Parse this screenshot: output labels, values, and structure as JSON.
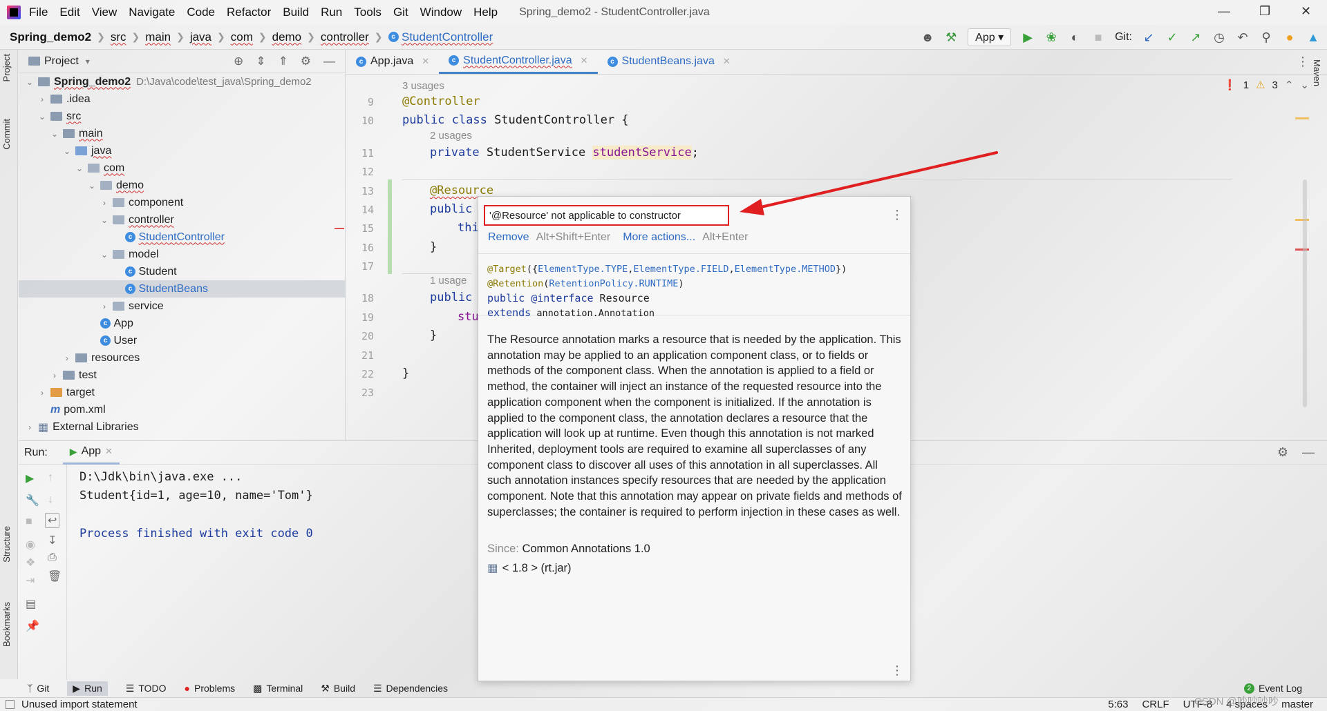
{
  "menu": {
    "items": [
      "File",
      "Edit",
      "View",
      "Navigate",
      "Code",
      "Refactor",
      "Build",
      "Run",
      "Tools",
      "Git",
      "Window",
      "Help"
    ],
    "title": "Spring_demo2 - StudentController.java"
  },
  "breadcrumb": [
    "Spring_demo2",
    "src",
    "main",
    "java",
    "com",
    "demo",
    "controller",
    "StudentController"
  ],
  "toolbar": {
    "run_config": "App",
    "git_label": "Git:"
  },
  "side_tabs": {
    "project": "Project",
    "commit": "Commit",
    "structure": "Structure",
    "bookmarks": "Bookmarks",
    "maven": "Maven"
  },
  "project_panel": {
    "title": "Project",
    "root_name": "Spring_demo2",
    "root_path": "D:\\Java\\code\\test_java\\Spring_demo2",
    "items": {
      "idea": ".idea",
      "src": "src",
      "main": "main",
      "java": "java",
      "com": "com",
      "demo": "demo",
      "component": "component",
      "controller": "controller",
      "studentcontroller": "StudentController",
      "model": "model",
      "student": "Student",
      "studentbeans": "StudentBeans",
      "service": "service",
      "app": "App",
      "user": "User",
      "resources": "resources",
      "test": "test",
      "target": "target",
      "pom": "pom.xml",
      "extlibs": "External Libraries"
    }
  },
  "editor": {
    "tabs": [
      "App.java",
      "StudentController.java",
      "StudentBeans.java"
    ],
    "active_tab": "StudentController.java",
    "inspection": {
      "errors": "1",
      "warnings": "3"
    },
    "line_numbers": [
      "9",
      "10",
      "11",
      "12",
      "13",
      "14",
      "15",
      "16",
      "17",
      "18",
      "19",
      "20",
      "21",
      "22",
      "23"
    ],
    "hints": {
      "h1": "3 usages",
      "h2": "2 usages",
      "h3": "1 usage"
    },
    "code": {
      "l9": "@Controller",
      "l10_kw": "public class",
      "l10_rest": " StudentController {",
      "l11_kw": "private",
      "l11_type": " StudentService ",
      "l11_field": "studentService",
      "l11_end": ";",
      "l13": "@Resource",
      "l14": "public",
      "l15": "thi",
      "l16": "}",
      "l18": "public",
      "l19": "stu",
      "l20": "}",
      "l22": "}"
    }
  },
  "popup": {
    "error": "'@Resource' not applicable to constructor",
    "action1": "Remove",
    "action1_shortcut": "Alt+Shift+Enter",
    "action2": "More actions...",
    "action2_shortcut": "Alt+Enter",
    "sig": {
      "target_ann": "@Target",
      "target_open": "({",
      "et1": "ElementType.TYPE",
      "et2": "ElementType.FIELD",
      "et3": "ElementType.METHOD",
      "target_close": "})",
      "retention_ann": "@Retention",
      "retention_open": "(",
      "retention_val": "RetentionPolicy.RUNTIME",
      "retention_close": ")",
      "decl_kw": "public @interface",
      "decl_name": " Resource",
      "extends_kw": "extends",
      "extends_name": " annotation.Annotation"
    },
    "description": "The Resource annotation marks a resource that is needed by the application. This annotation may be applied to an application component class, or to fields or methods of the component class. When the annotation is applied to a field or method, the container will inject an instance of the requested resource into the application component when the component is initialized. If the annotation is applied to the component class, the annotation declares a resource that the application will look up at runtime. Even though this annotation is not marked Inherited, deployment tools are required to examine all superclasses of any component class to discover all uses of this annotation in all superclasses. All such annotation instances specify resources that are needed by the application component. Note that this annotation may appear on private fields and methods of superclasses; the container is required to perform injection in these cases as well.",
    "since_label": "Since:",
    "since_value": "Common Annotations 1.0",
    "jdk": "< 1.8 > (rt.jar)"
  },
  "run_panel": {
    "label": "Run:",
    "tab": "App",
    "output": [
      "D:\\Jdk\\bin\\java.exe ...",
      "Student{id=1, age=10, name='Tom'}",
      "",
      "Process finished with exit code 0"
    ]
  },
  "bottom_tools": [
    "Git",
    "Run",
    "TODO",
    "Problems",
    "Terminal",
    "Build",
    "Dependencies"
  ],
  "event_log": {
    "count": "2",
    "label": "Event Log"
  },
  "status": {
    "message": "Unused import statement",
    "position": "5:63",
    "line_sep": "CRLF",
    "encoding": "UTF-8",
    "indent": "4 spaces",
    "branch": "master",
    "watermark": "CSDN @吵吵吵吵"
  },
  "colors": {
    "accent": "#4083c9",
    "error": "#e02020",
    "annotation": "#8a7a00",
    "keyword": "#1d3c9f"
  }
}
